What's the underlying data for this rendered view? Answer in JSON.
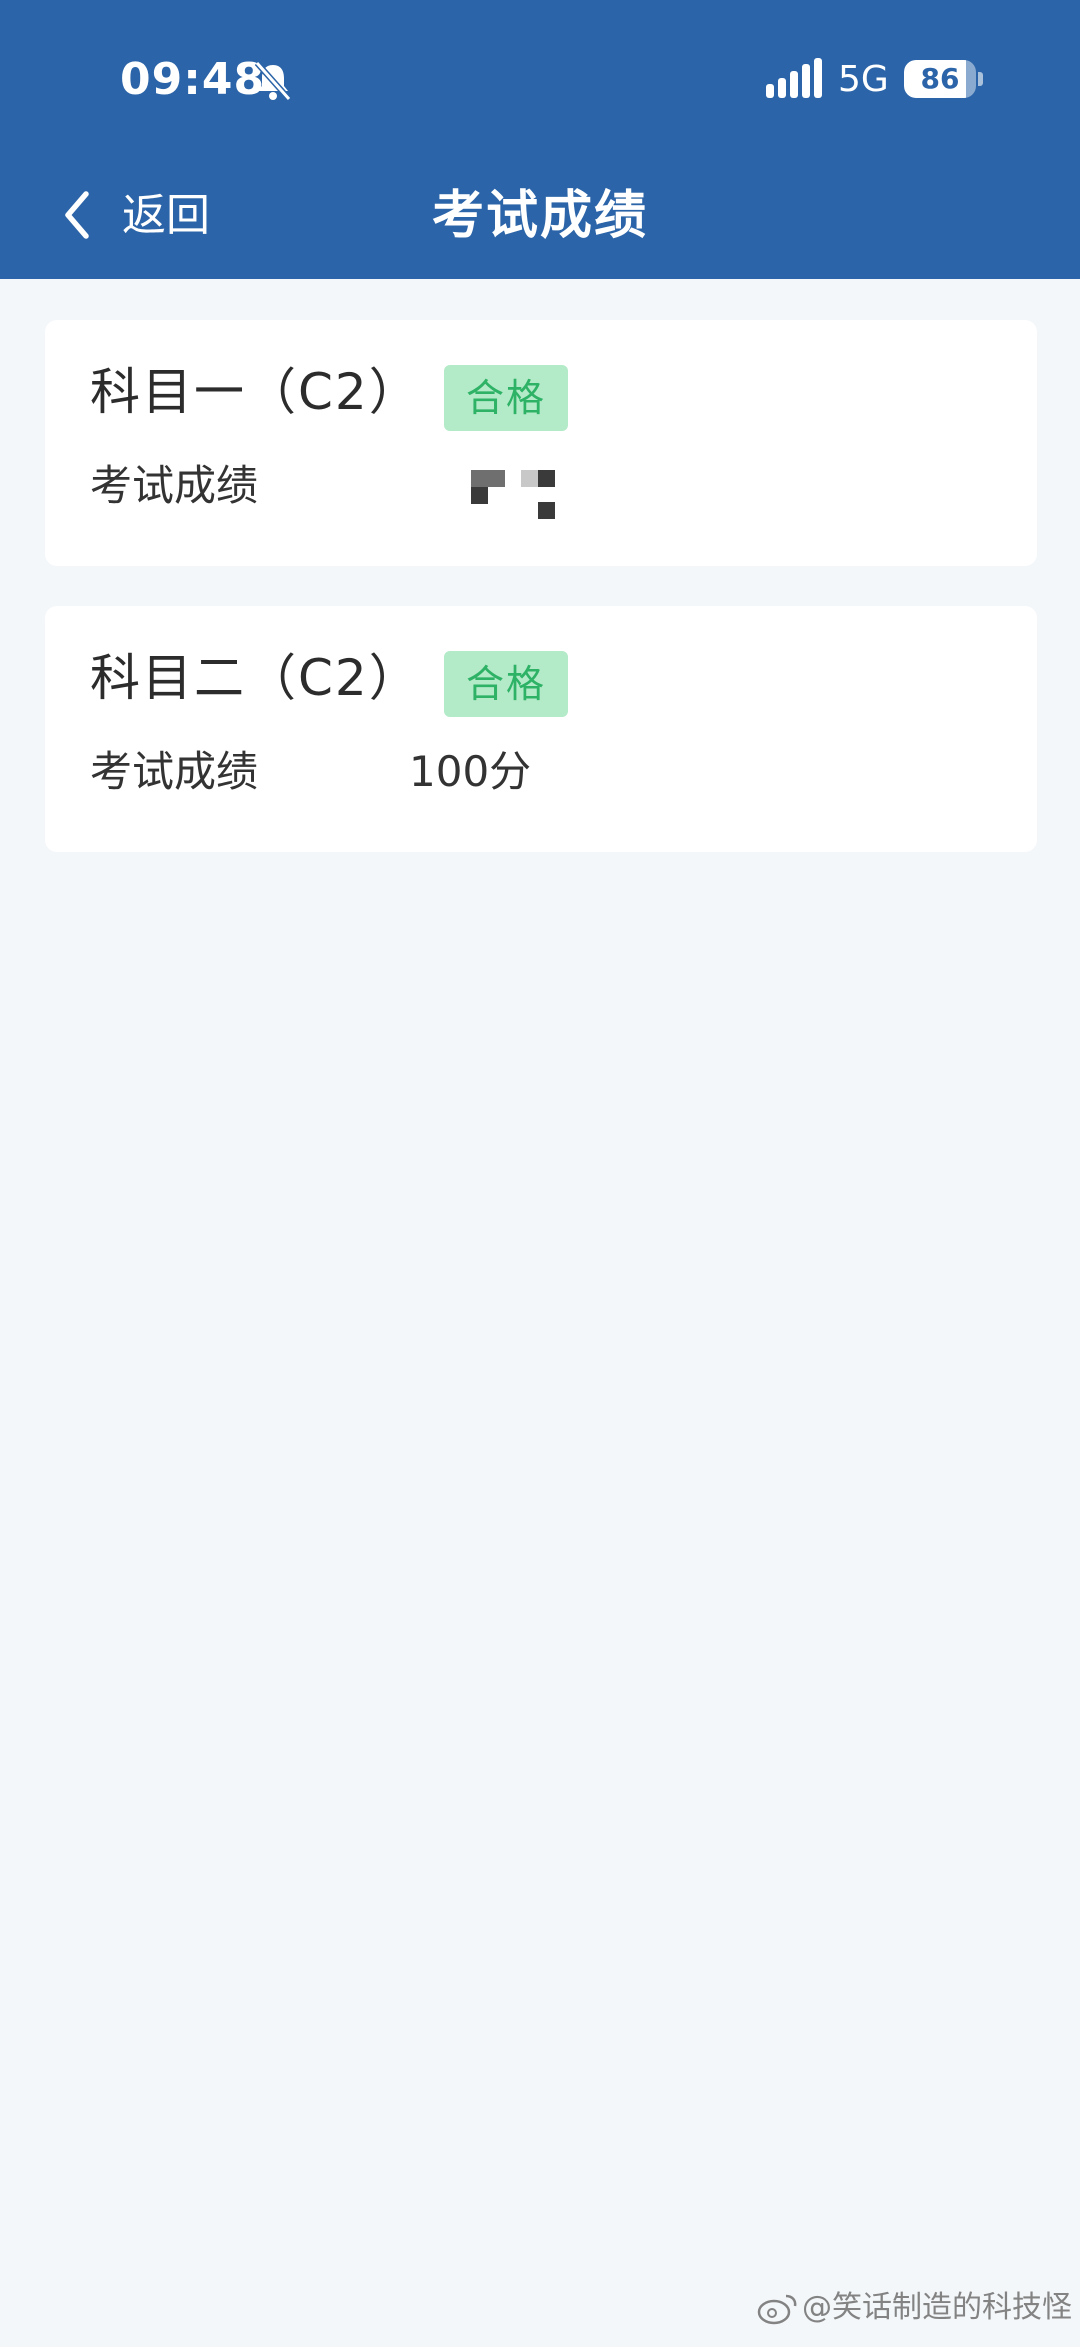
{
  "status_bar": {
    "time": "09:48",
    "network": "5G",
    "battery_level": "86",
    "battery_fraction": 0.86,
    "icons": [
      "bell-muted-icon",
      "signal-icon",
      "battery-icon"
    ]
  },
  "nav": {
    "back_label": "返回",
    "title": "考试成绩",
    "back_icon": "chevron-left-icon"
  },
  "results": [
    {
      "subject": "科目一（C2）",
      "status": "合格",
      "score_label": "考试成绩",
      "score_value": ""
    },
    {
      "subject": "科目二（C2）",
      "status": "合格",
      "score_label": "考试成绩",
      "score_value": "100分"
    }
  ],
  "watermark": {
    "text": "@笑话制造的科技怪",
    "icon": "weibo-icon"
  },
  "colors": {
    "header": "#2b64a8",
    "page_background": "#f3f7f9",
    "badge_background": "#b3eac7",
    "badge_text": "#2db266"
  }
}
